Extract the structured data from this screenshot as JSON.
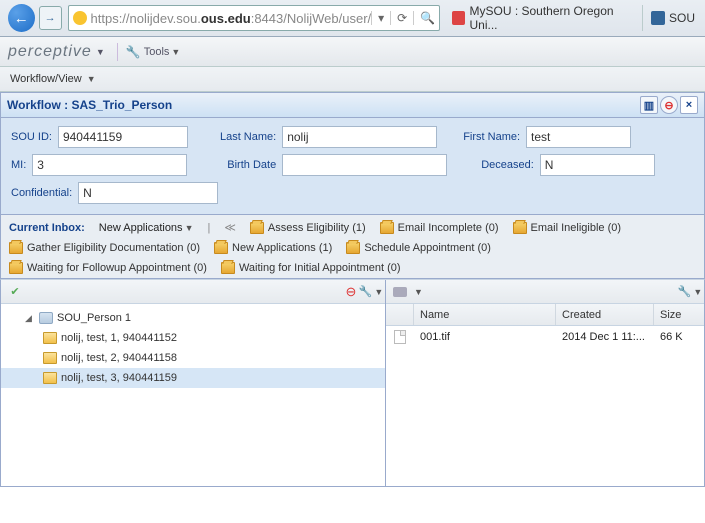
{
  "browser": {
    "url_prefix": "https://",
    "url_host": "nolijdev.sou.",
    "url_bold": "ous.edu",
    "url_suffix": ":8443/NolijWeb/user/",
    "tab1": "MySOU : Southern Oregon Uni...",
    "tab2": "SOU"
  },
  "app": {
    "brand": "perceptive",
    "tools": "Tools"
  },
  "workflow_bar": "Workflow/View",
  "panel_title": "Workflow : SAS_Trio_Person",
  "form": {
    "sou_id_label": "SOU ID:",
    "sou_id": "940441159",
    "last_name_label": "Last Name:",
    "last_name": "nolij",
    "first_name_label": "First Name:",
    "first_name": "test",
    "mi_label": "MI:",
    "mi": "3",
    "birth_date_label": "Birth Date",
    "birth_date": "",
    "deceased_label": "Deceased:",
    "deceased": "N",
    "confidential_label": "Confidential:",
    "confidential": "N"
  },
  "inbox": {
    "label": "Current Inbox:",
    "selected": "New Applications",
    "chips": [
      "Assess Eligibility (1)",
      "Email Incomplete (0)",
      "Email Ineligible (0)",
      "Gather Eligibility Documentation (0)",
      "New Applications (1)",
      "Schedule Appointment (0)",
      "Waiting for Followup Appointment (0)",
      "Waiting for Initial Appointment (0)"
    ]
  },
  "tree": {
    "root": "SOU_Person 1",
    "children": [
      "nolij, test, 1, 940441152",
      "nolij, test, 2, 940441158",
      "nolij, test, 3, 940441159"
    ]
  },
  "files": {
    "headers": {
      "name": "Name",
      "created": "Created",
      "size": "Size"
    },
    "rows": [
      {
        "name": "001.tif",
        "created": "2014 Dec 1 11:...",
        "size": "66 K"
      }
    ]
  }
}
